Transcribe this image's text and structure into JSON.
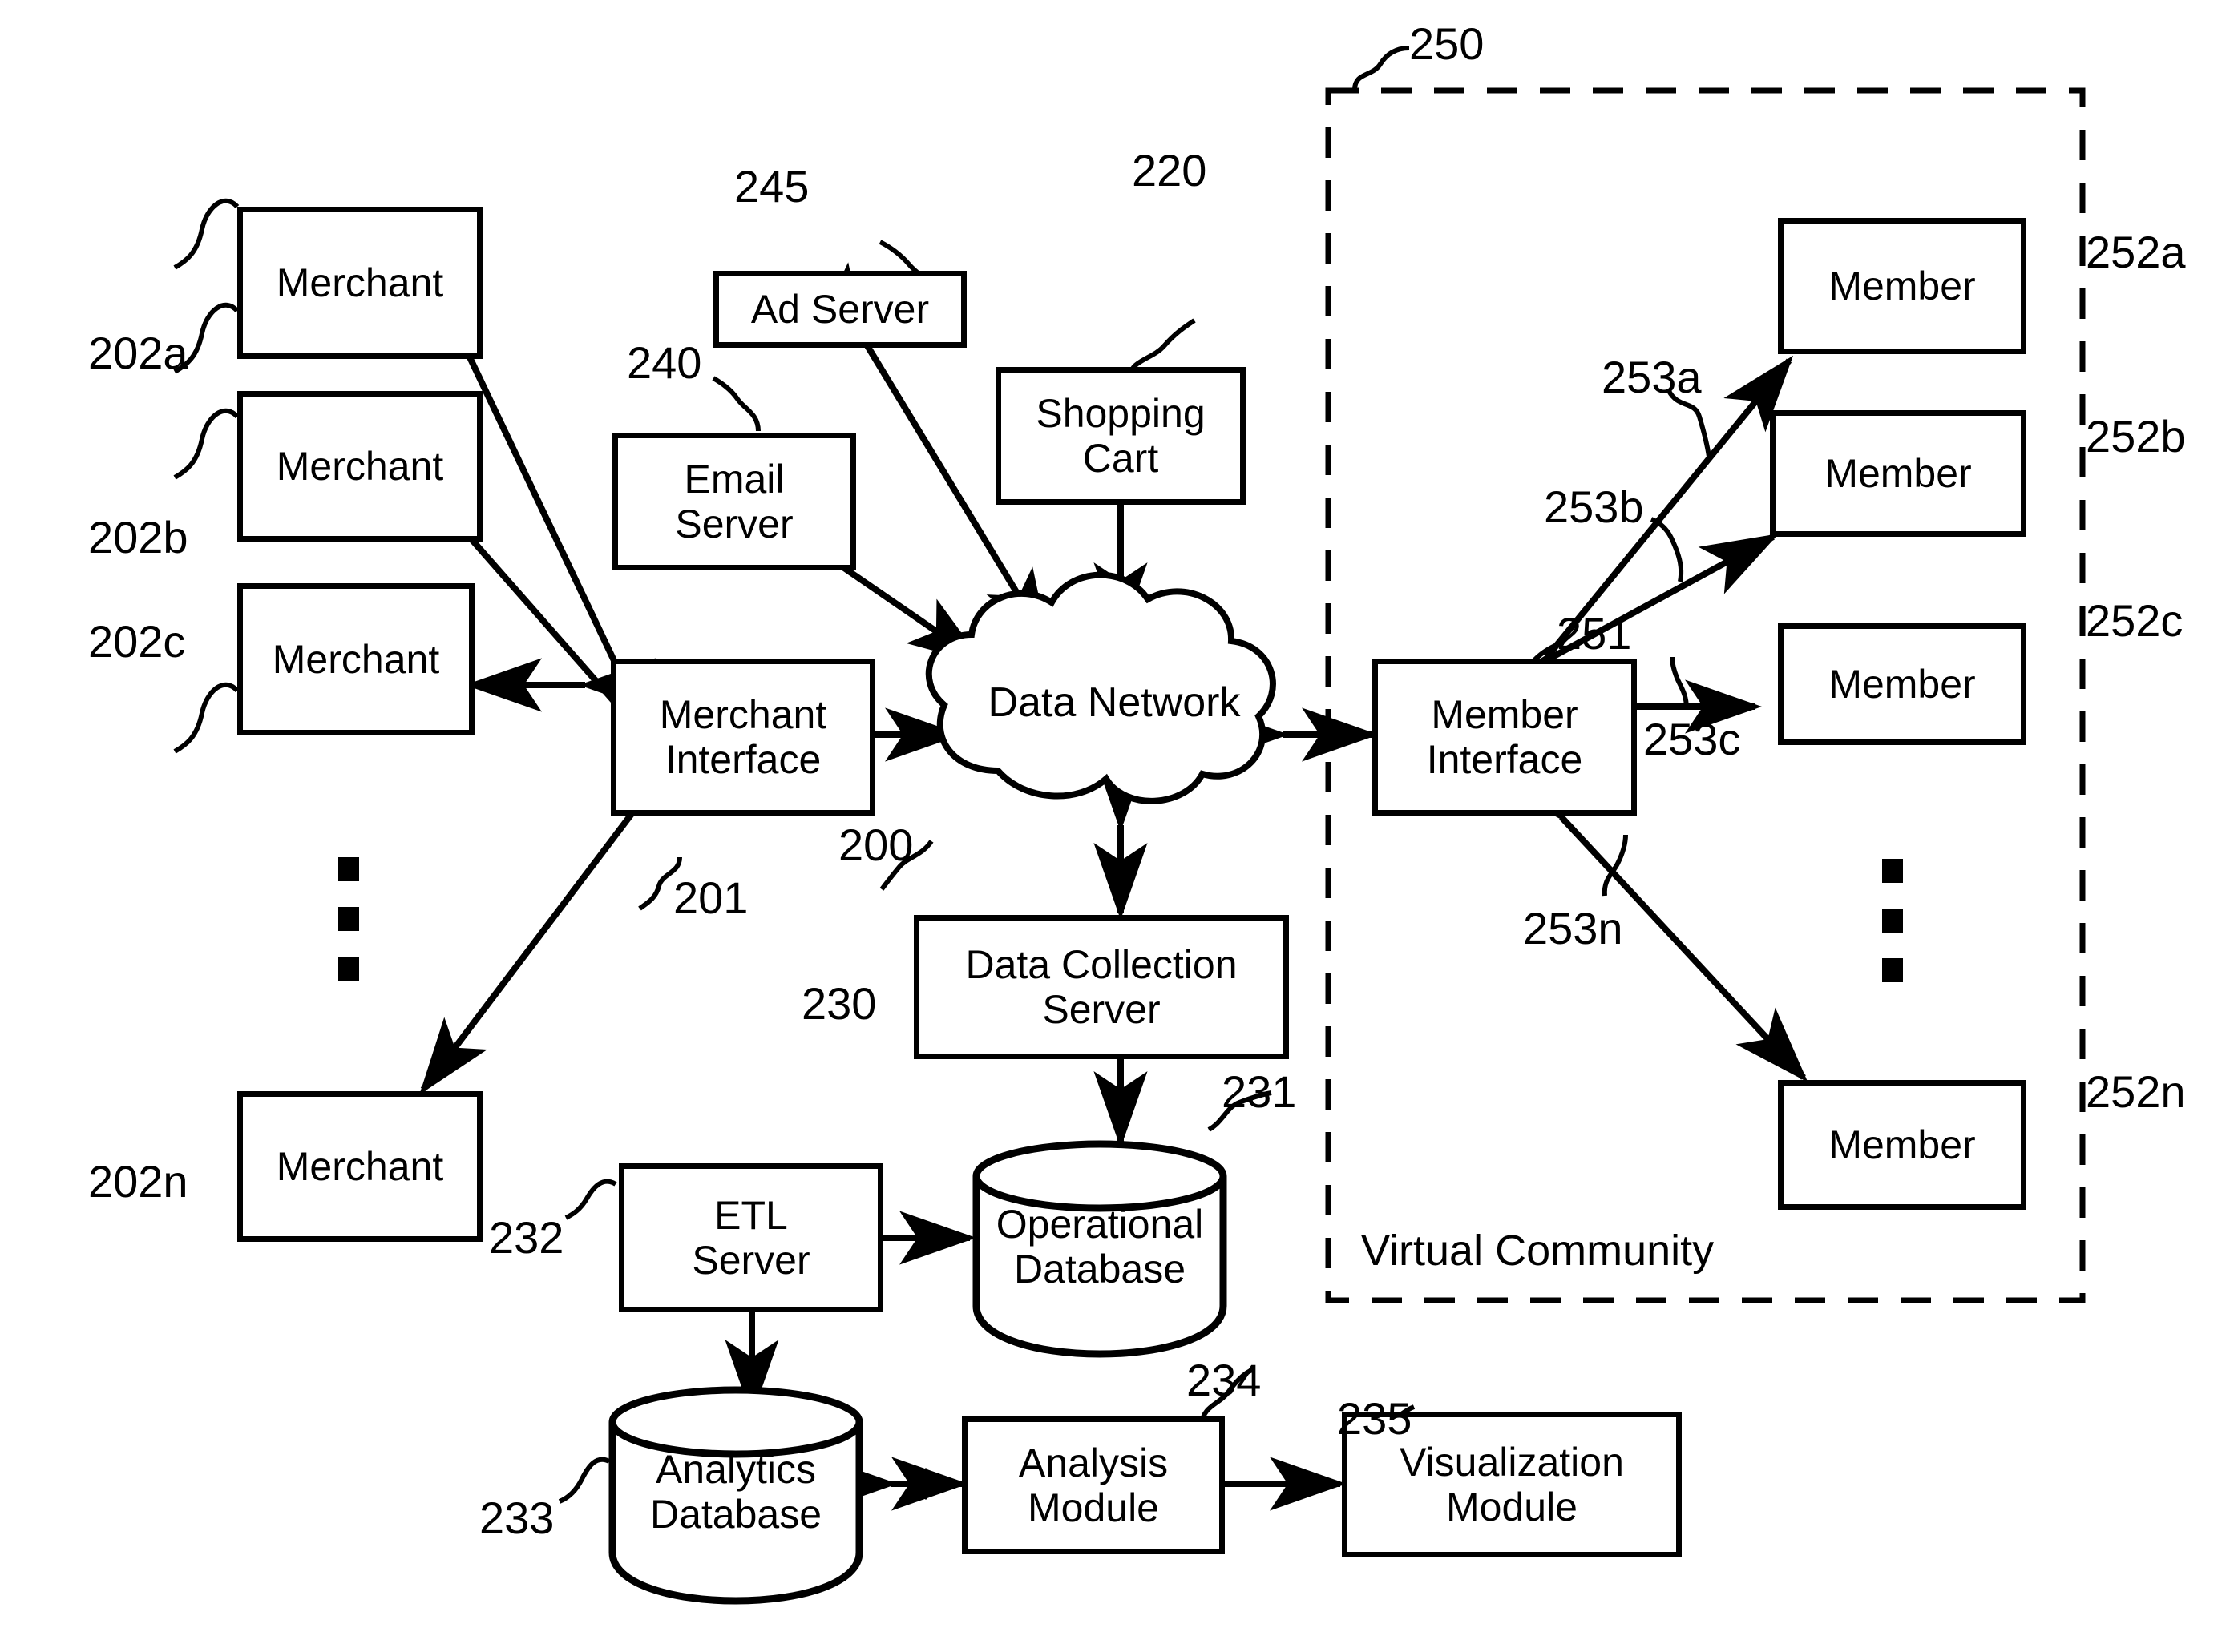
{
  "figure": {
    "type": "patent-system-block-diagram",
    "caption_virtual_community": "Virtual Community"
  },
  "nodes": {
    "merchant_a": "Merchant",
    "merchant_b": "Merchant",
    "merchant_c": "Merchant",
    "merchant_n": "Merchant",
    "merchant_interface": "Merchant\nInterface",
    "merchant_interface_l1": "Merchant",
    "merchant_interface_l2": "Interface",
    "ad_server": "Ad Server",
    "email_server_l1": "Email",
    "email_server_l2": "Server",
    "shopping_cart_l1": "Shopping",
    "shopping_cart_l2": "Cart",
    "data_network_l1": "Data",
    "data_network_l2": "Network",
    "member_interface_l1": "Member",
    "member_interface_l2": "Interface",
    "member_a": "Member",
    "member_b": "Member",
    "member_c": "Member",
    "member_n": "Member",
    "data_collection_server_l1": "Data Collection",
    "data_collection_server_l2": "Server",
    "operational_database_l1": "Operational",
    "operational_database_l2": "Database",
    "etl_server_l1": "ETL",
    "etl_server_l2": "Server",
    "analytics_database_l1": "Analytics",
    "analytics_database_l2": "Database",
    "analysis_module_l1": "Analysis",
    "analysis_module_l2": "Module",
    "visualization_module_l1": "Visualization",
    "visualization_module_l2": "Module"
  },
  "reference_numerals": {
    "r200": "200",
    "r201": "201",
    "r202a": "202a",
    "r202b": "202b",
    "r202c": "202c",
    "r202n": "202n",
    "r220": "220",
    "r230": "230",
    "r231": "231",
    "r232": "232",
    "r233": "233",
    "r234": "234",
    "r235": "235",
    "r240": "240",
    "r245": "245",
    "r250": "250",
    "r251": "251",
    "r252a": "252a",
    "r252b": "252b",
    "r252c": "252c",
    "r252n": "252n",
    "r253a": "253a",
    "r253b": "253b",
    "r253c": "253c",
    "r253n": "253n"
  },
  "colors": {
    "line": "#000000",
    "background": "#ffffff"
  }
}
